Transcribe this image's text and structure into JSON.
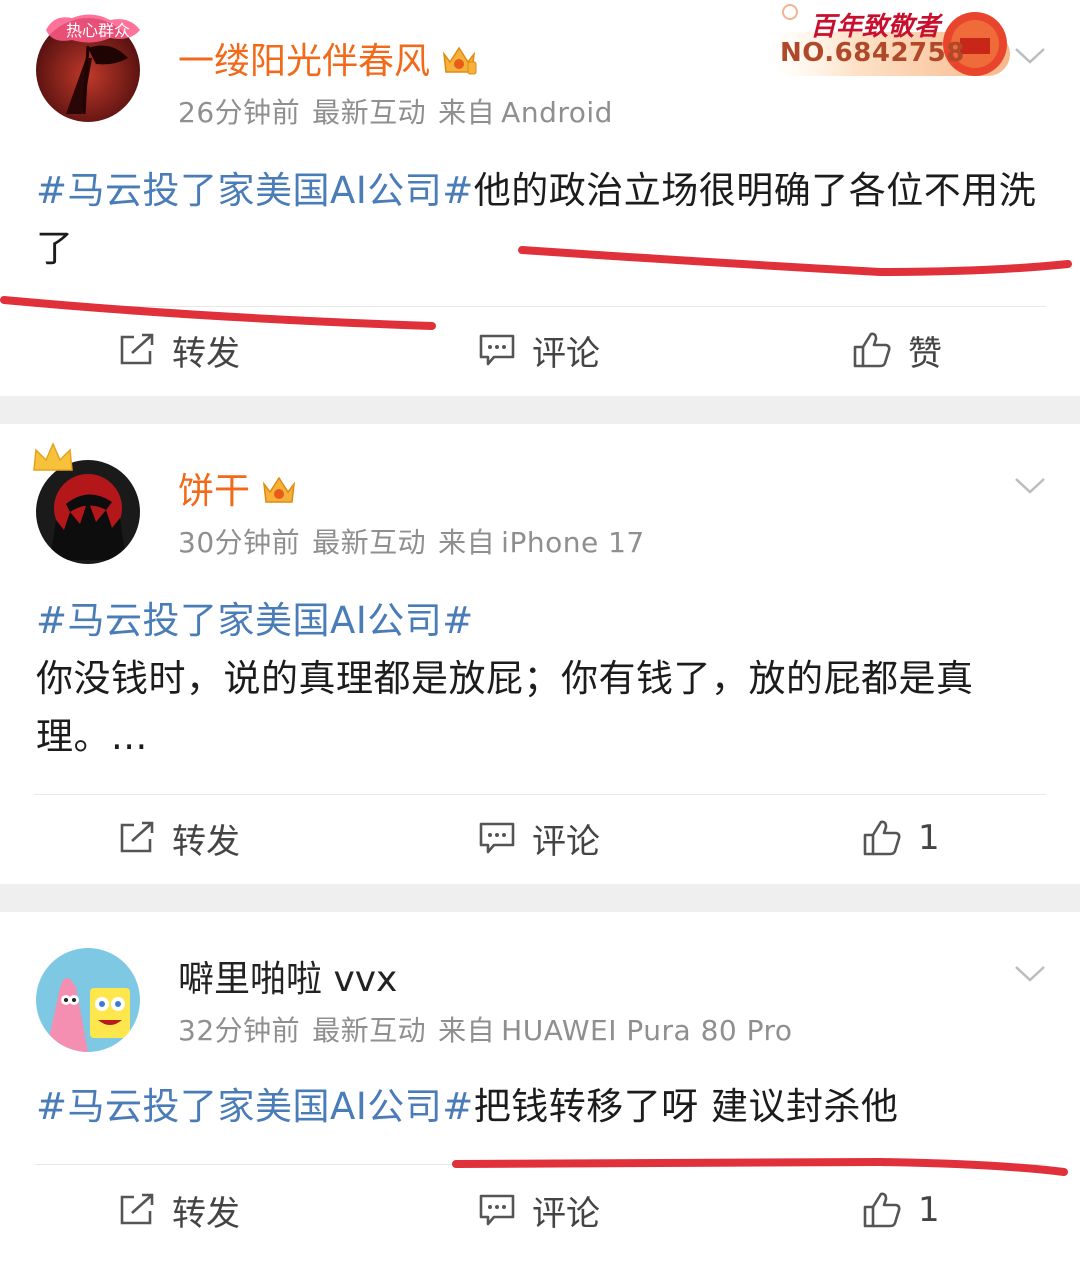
{
  "posts": [
    {
      "username": "一缕阳光伴春风",
      "time": "26分钟前",
      "tag": "最新互动",
      "source": "来自",
      "device": "Android",
      "topic": "#马云投了家美国AI公司#",
      "text": "他的政治立场很明确了各位不用洗了",
      "avatar_badge_text": "热心群众",
      "medal_title": "百年致敬者",
      "medal_no": "NO.6842758",
      "actions": {
        "repost": "转发",
        "comment": "评论",
        "like": "赞"
      }
    },
    {
      "username": "饼干",
      "time": "30分钟前",
      "tag": "最新互动",
      "source": "来自",
      "device": "iPhone 17",
      "topic": "#马云投了家美国AI公司#",
      "text": "你没钱时，说的真理都是放屁；你有钱了，放的屁都是真理。...",
      "actions": {
        "repost": "转发",
        "comment": "评论",
        "like": "1"
      }
    },
    {
      "username": "噼里啪啦 vvx",
      "time": "32分钟前",
      "tag": "最新互动",
      "source": "来自",
      "device": "HUAWEI Pura 80 Pro",
      "topic": "#马云投了家美国AI公司#",
      "text": "把钱转移了呀 建议封杀他",
      "actions": {
        "repost": "转发",
        "comment": "评论",
        "like": "1"
      }
    }
  ],
  "colors": {
    "vip_name": "#f26a19",
    "topic": "#4a7cb8",
    "meta": "#8f8f8f",
    "annotation_underline": "#e0303a",
    "separator": "#efefef"
  },
  "icons": [
    "repost-icon",
    "comment-icon",
    "like-icon",
    "chevron-down-icon",
    "vip-crown-icon"
  ]
}
